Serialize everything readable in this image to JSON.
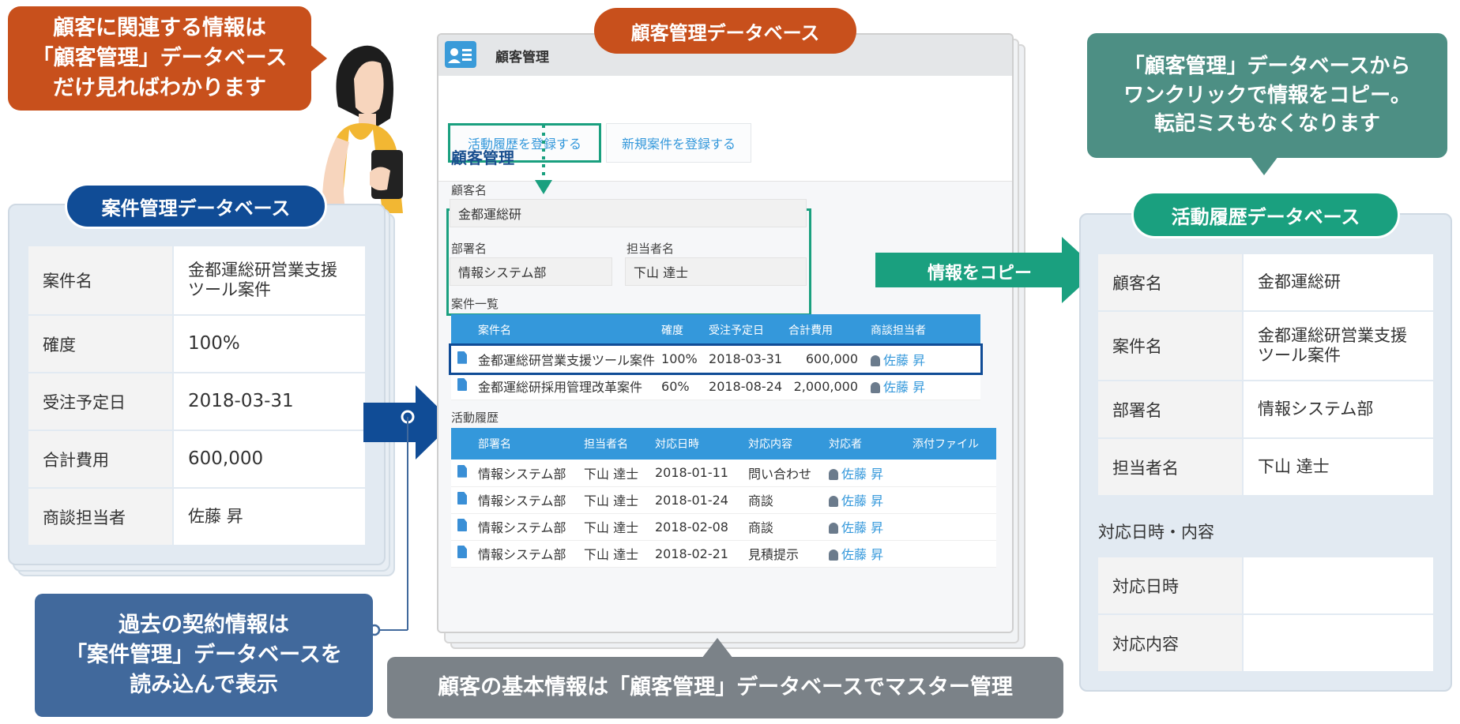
{
  "callouts": {
    "top_left": [
      "顧客に関連する情報は",
      "「顧客管理」データベース",
      "だけ見ればわかります"
    ],
    "top_right": [
      "「顧客管理」データベースから",
      "ワンクリックで情報をコピー。",
      "転記ミスもなくなります"
    ],
    "bottom_left": [
      "過去の契約情報は",
      "「案件管理」データベースを",
      "読み込んで表示"
    ],
    "bottom_center": "顧客の基本情報は「顧客管理」データベースでマスター管理"
  },
  "labels": {
    "center_db": "顧客管理データベース",
    "left_db": "案件管理データベース",
    "right_db": "活動履歴データベース",
    "copy_arrow": "情報をコピー"
  },
  "left_table": [
    {
      "key": "案件名",
      "value": [
        "金都運総研営業支援",
        "ツール案件"
      ]
    },
    {
      "key": "確度",
      "value": [
        "100%"
      ]
    },
    {
      "key": "受注予定日",
      "value": [
        "2018-03-31"
      ]
    },
    {
      "key": "合計費用",
      "value": [
        "600,000"
      ]
    },
    {
      "key": "商談担当者",
      "value": [
        "佐藤 昇"
      ]
    }
  ],
  "app": {
    "title": "顧客管理",
    "buttons": {
      "register_activity": "活動履歴を登録する",
      "register_deal": "新規案件を登録する"
    },
    "section_title": "顧客管理",
    "fields": {
      "customer_label": "顧客名",
      "customer_value": "金都運総研",
      "dept_label": "部署名",
      "dept_value": "情報システム部",
      "person_label": "担当者名",
      "person_value": "下山 達士"
    },
    "deals": {
      "title": "案件一覧",
      "headers": [
        "案件名",
        "確度",
        "受注予定日",
        "合計費用",
        "商談担当者"
      ],
      "rows": [
        [
          "金都運総研営業支援ツール案件",
          "100%",
          "2018-03-31",
          "600,000",
          "佐藤 昇"
        ],
        [
          "金都運総研採用管理改革案件",
          "60%",
          "2018-08-24",
          "2,000,000",
          "佐藤 昇"
        ]
      ]
    },
    "activities": {
      "title": "活動履歴",
      "headers": [
        "部署名",
        "担当者名",
        "対応日時",
        "対応内容",
        "対応者",
        "添付ファイル"
      ],
      "rows": [
        [
          "情報システム部",
          "下山 達士",
          "2018-01-11",
          "問い合わせ",
          "佐藤 昇",
          ""
        ],
        [
          "情報システム部",
          "下山 達士",
          "2018-01-24",
          "商談",
          "佐藤 昇",
          ""
        ],
        [
          "情報システム部",
          "下山 達士",
          "2018-02-08",
          "商談",
          "佐藤 昇",
          ""
        ],
        [
          "情報システム部",
          "下山 達士",
          "2018-02-21",
          "見積提示",
          "佐藤 昇",
          ""
        ]
      ]
    }
  },
  "right_table": [
    {
      "key": "顧客名",
      "value": [
        "金都運総研"
      ]
    },
    {
      "key": "案件名",
      "value": [
        "金都運総研営業支援",
        "ツール案件"
      ]
    },
    {
      "key": "部署名",
      "value": [
        "情報システム部"
      ]
    },
    {
      "key": "担当者名",
      "value": [
        "下山 達士"
      ]
    }
  ],
  "right_section": "対応日時・内容",
  "right_table2": [
    {
      "key": "対応日時",
      "value": [
        ""
      ]
    },
    {
      "key": "対応内容",
      "value": [
        ""
      ]
    }
  ],
  "colors": {
    "orange": "#c8501c",
    "navy": "#104c96",
    "teal": "#1aa07f",
    "teal_callout": "#4d8f84",
    "steel": "#41699c",
    "gray": "#7b8288",
    "blue_header": "#3498db"
  }
}
